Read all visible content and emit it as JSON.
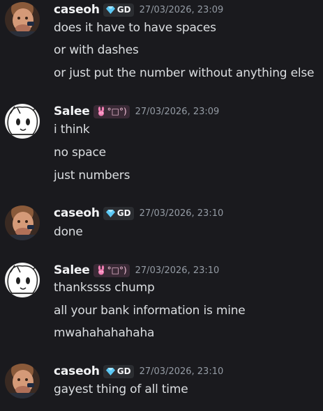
{
  "users": {
    "caseoh": {
      "name": "caseoh",
      "tag": "GD"
    },
    "salee": {
      "name": "Salee",
      "tag": "°□°)"
    }
  },
  "groups": [
    {
      "author": "caseoh",
      "timestamp": "27/03/2026, 23:09",
      "lines": [
        "does it have to have spaces",
        "or with dashes",
        "or just put the number without anything else"
      ]
    },
    {
      "author": "salee",
      "timestamp": "27/03/2026, 23:09",
      "lines": [
        "i think",
        "no space",
        "just numbers"
      ]
    },
    {
      "author": "caseoh",
      "timestamp": "27/03/2026, 23:10",
      "lines": [
        "done"
      ]
    },
    {
      "author": "salee",
      "timestamp": "27/03/2026, 23:10",
      "lines": [
        "thankssss chump",
        "all your bank information is mine",
        "mwahahahahaha"
      ]
    },
    {
      "author": "caseoh",
      "timestamp": "27/03/2026, 23:10",
      "lines": [
        "gayest thing of all time"
      ]
    }
  ],
  "colors": {
    "background": "#1a1a1e",
    "username": "#f2f3f5",
    "text": "#dbdee1",
    "timestamp": "#949ba4",
    "gem": "#5bc8f5",
    "bunny": "#f47fb5"
  }
}
